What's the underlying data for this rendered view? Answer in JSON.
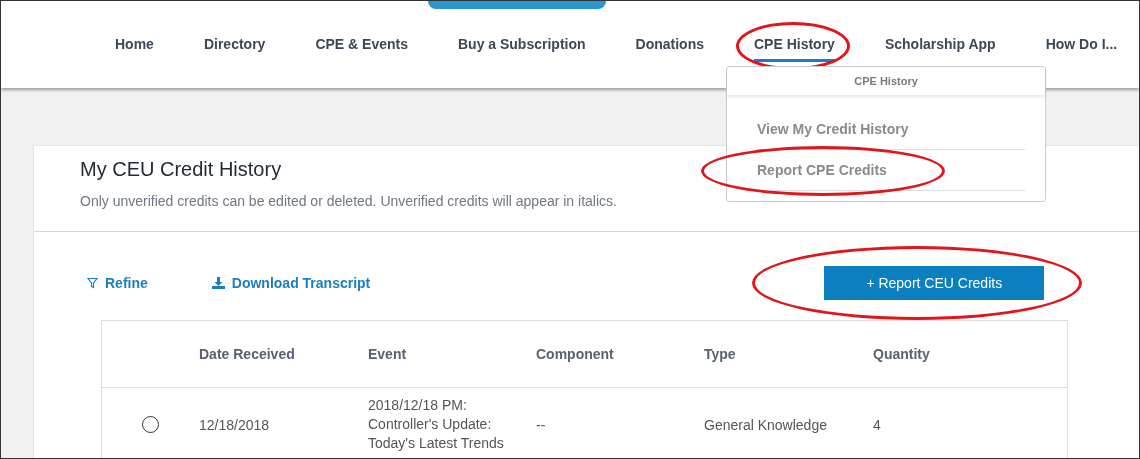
{
  "nav": {
    "items": [
      {
        "label": "Home",
        "selected": false,
        "circled": false
      },
      {
        "label": "Directory",
        "selected": false,
        "circled": false
      },
      {
        "label": "CPE & Events",
        "selected": false,
        "circled": false
      },
      {
        "label": "Buy a Subscription",
        "selected": false,
        "circled": false
      },
      {
        "label": "Donations",
        "selected": false,
        "circled": false
      },
      {
        "label": "CPE History",
        "selected": true,
        "circled": true
      },
      {
        "label": "Scholarship App",
        "selected": false,
        "circled": false
      },
      {
        "label": "How Do I...",
        "selected": false,
        "circled": false
      }
    ]
  },
  "dropdown": {
    "title": "CPE History",
    "items": [
      {
        "label": "View My Credit History",
        "circled": false
      },
      {
        "label": "Report CPE Credits",
        "circled": true
      }
    ]
  },
  "card": {
    "title": "My CEU Credit History",
    "subtitle": "Only unverified credits can be edited or deleted. Unverified credits will appear in italics."
  },
  "toolbar": {
    "refine": "Refine",
    "download": "Download Transcript",
    "report_button": {
      "label": "+ Report CEU Credits",
      "circled": true
    }
  },
  "table": {
    "columns": [
      "Date Received",
      "Event",
      "Component",
      "Type",
      "Quantity"
    ],
    "rows": [
      {
        "selected": false,
        "cells": [
          "12/18/2018",
          "2018/12/18 PM: Controller's Update: Today's Latest Trends",
          "--",
          "General Knowledge",
          "4"
        ]
      }
    ]
  }
}
